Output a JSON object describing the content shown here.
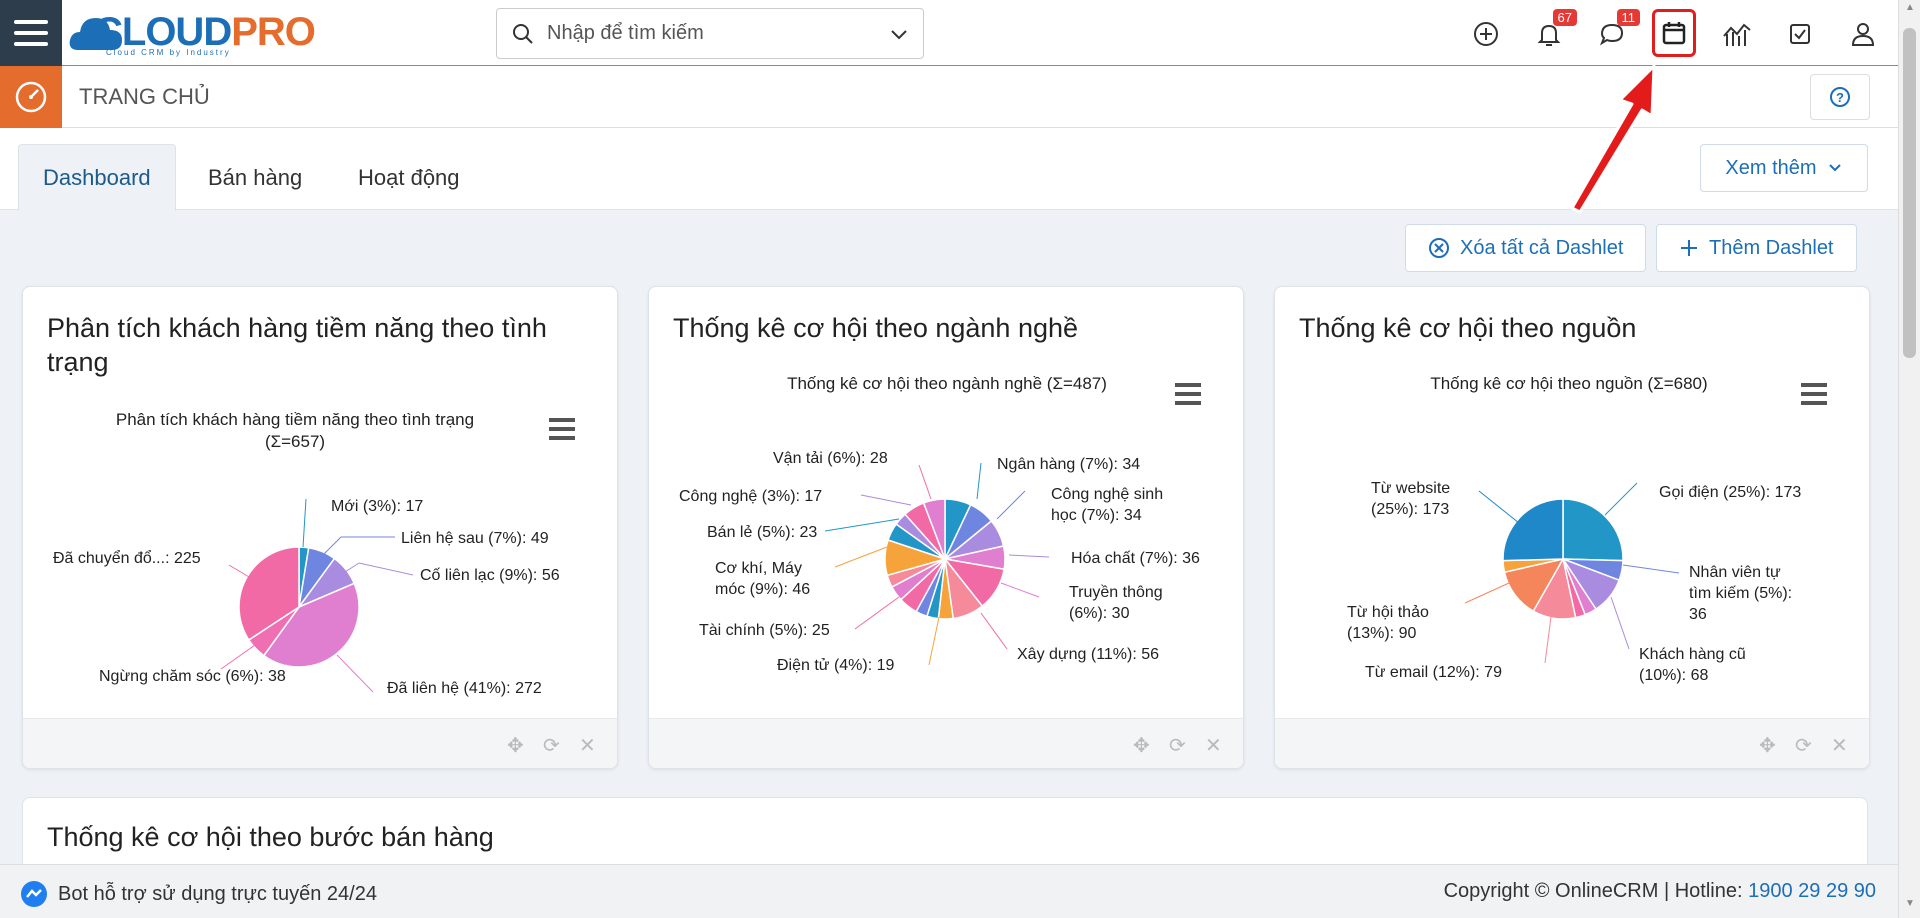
{
  "app": {
    "logo_main_a": "CLOUD",
    "logo_main_b": "PRO",
    "logo_sub": "Cloud CRM by Industry"
  },
  "search": {
    "placeholder": "Nhập để tìm kiếm"
  },
  "toolbar": {
    "notif_count": "67",
    "chat_count": "11",
    "icons": [
      "plus-circle-icon",
      "bell-icon",
      "chat-icon",
      "calendar-icon",
      "chart-icon",
      "checkbox-icon",
      "user-icon"
    ]
  },
  "subheader": {
    "title": "TRANG CHỦ"
  },
  "tabs": [
    {
      "label": "Dashboard",
      "active": true
    },
    {
      "label": "Bán hàng"
    },
    {
      "label": "Hoạt động"
    }
  ],
  "more": {
    "label": "Xem thêm"
  },
  "actions": {
    "clear": "Xóa tất cả Dashlet",
    "add": "Thêm Dashlet"
  },
  "dashlets": [
    {
      "title": "Phân tích khách hàng tiềm năng theo tình trạng",
      "chart_title_1": "Phân tích khách hàng tiềm năng theo tình trạng",
      "chart_title_2": "(Σ=657)"
    },
    {
      "title": "Thống kê cơ hội theo ngành nghề",
      "chart_title_1": "Thống kê cơ hội theo ngành nghề (Σ=487)"
    },
    {
      "title": "Thống kê cơ hội theo nguồn",
      "chart_title_1": "Thống kê cơ hội theo nguồn (Σ=680)"
    }
  ],
  "wide_dashlet": {
    "title": "Thống kê cơ hội theo bước bán hàng"
  },
  "bottom": {
    "chat_label": "Bot hỗ trợ sử dụng trực tuyến 24/24",
    "copyright": "Copyright © OnlineCRM",
    "hotline_label": "Hotline: ",
    "hotline": "1900 29 29 90"
  },
  "chart_data": [
    {
      "type": "pie",
      "title": "Phân tích khách hàng tiềm năng theo tình trạng (Σ=657)",
      "slices": [
        {
          "label": "Mới (3%): 17",
          "value": 17,
          "color": "#2196c7"
        },
        {
          "label": "Liên hệ sau (7%): 49",
          "value": 49,
          "color": "#6f86e0"
        },
        {
          "label": "Cố liên lạc (9%): 56",
          "value": 56,
          "color": "#a98be0"
        },
        {
          "label": "Đã liên hệ (41%): 272",
          "value": 272,
          "color": "#e07fd0"
        },
        {
          "label": "Ngừng chăm sóc (6%): 38",
          "value": 38,
          "color": "#f06fb2"
        },
        {
          "label": "Đã chuyển đổ...: 225",
          "value": 225,
          "color": "#f26aa5"
        }
      ]
    },
    {
      "type": "pie",
      "title": "Thống kê cơ hội theo ngành nghề (Σ=487)",
      "slices": [
        {
          "label": "Ngân hàng (7%): 34",
          "value": 34,
          "color": "#2196c7"
        },
        {
          "label": "Công nghệ sinh học (7%): 34",
          "value": 34,
          "color": "#6f86e0"
        },
        {
          "label": "Hóa chất (7%): 36",
          "value": 36,
          "color": "#a98be0"
        },
        {
          "label": "Truyền thông (6%): 30",
          "value": 30,
          "color": "#e07fd0"
        },
        {
          "label": "Xây dựng (11%): 56",
          "value": 56,
          "color": "#f26aa5"
        },
        {
          "label": "",
          "value": 41,
          "color": "#f58a9a"
        },
        {
          "label": "Điện tử (4%): 19",
          "value": 19,
          "color": "#f7a33c"
        },
        {
          "label": "",
          "value": 15,
          "color": "#2196c7"
        },
        {
          "label": "",
          "value": 15,
          "color": "#6f86e0"
        },
        {
          "label": "Tài chính (5%): 25",
          "value": 25,
          "color": "#f26aa5"
        },
        {
          "label": "",
          "value": 20,
          "color": "#e07fd0"
        },
        {
          "label": "",
          "value": 16,
          "color": "#f58a9a"
        },
        {
          "label": "Cơ khí, Máy móc (9%): 46",
          "value": 46,
          "color": "#f7a33c"
        },
        {
          "label": "Bán lẻ (5%): 23",
          "value": 23,
          "color": "#2196c7"
        },
        {
          "label": "Công nghệ (3%): 17",
          "value": 17,
          "color": "#a98be0"
        },
        {
          "label": "Vận tải (6%): 28",
          "value": 28,
          "color": "#f26aa5"
        },
        {
          "label": "",
          "value": 28,
          "color": "#e07fd0"
        }
      ]
    },
    {
      "type": "pie",
      "title": "Thống kê cơ hội theo nguồn (Σ=680)",
      "slices": [
        {
          "label": "Gọi điện (25%): 173",
          "value": 173,
          "color": "#2196c7"
        },
        {
          "label": "Nhân viên tự tìm kiếm (5%): 36",
          "value": 36,
          "color": "#6f86e0"
        },
        {
          "label": "Khách hàng cũ (10%): 68",
          "value": 68,
          "color": "#a98be0"
        },
        {
          "label": "",
          "value": 22,
          "color": "#e07fd0"
        },
        {
          "label": "",
          "value": 18,
          "color": "#f26aa5"
        },
        {
          "label": "Từ email (12%): 79",
          "value": 79,
          "color": "#f58a9a"
        },
        {
          "label": "Từ hội thảo (13%): 90",
          "value": 90,
          "color": "#f5855a"
        },
        {
          "label": "",
          "value": 21,
          "color": "#f7a33c"
        },
        {
          "label": "Từ website (25%): 173",
          "value": 173,
          "color": "#1e88c8"
        }
      ]
    }
  ]
}
